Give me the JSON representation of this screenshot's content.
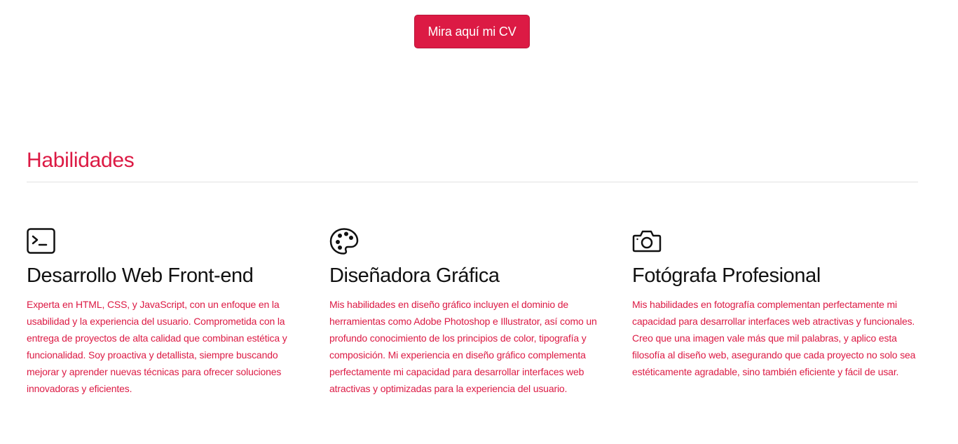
{
  "cta": {
    "label": "Mira aquí mi CV"
  },
  "skills_section": {
    "title": "Habilidades",
    "items": [
      {
        "icon": "terminal-icon",
        "title": "Desarrollo Web Front-end",
        "description": "Experta en HTML, CSS, y JavaScript, con un enfoque en la usabilidad y la experiencia del usuario. Comprometida con la entrega de proyectos de alta calidad que combinan estética y funcionalidad. Soy proactiva y detallista, siempre buscando mejorar y aprender nuevas técnicas para ofrecer soluciones innovadoras y eficientes."
      },
      {
        "icon": "palette-icon",
        "title": "Diseñadora Gráfica",
        "description": "Mis habilidades en diseño gráfico incluyen el dominio de herramientas como Adobe Photoshop e Illustrator, así como un profundo conocimiento de los principios de color, tipografía y composición. Mi experiencia en diseño gráfico complementa perfectamente mi capacidad para desarrollar interfaces web atractivas y optimizadas para la experiencia del usuario."
      },
      {
        "icon": "camera-icon",
        "title": "Fotógrafa Profesional",
        "description": "Mis habilidades en fotografía complementan perfectamente mi capacidad para desarrollar interfaces web atractivas y funcionales. Creo que una imagen vale más que mil palabras, y aplico esta filosofía al diseño web, asegurando que cada proyecto no solo sea estéticamente agradable, sino también eficiente y fácil de usar."
      }
    ]
  },
  "colors": {
    "accent": "#dc1a44",
    "heading_text": "#111111",
    "divider": "#e3e3e3",
    "background": "#ffffff"
  }
}
